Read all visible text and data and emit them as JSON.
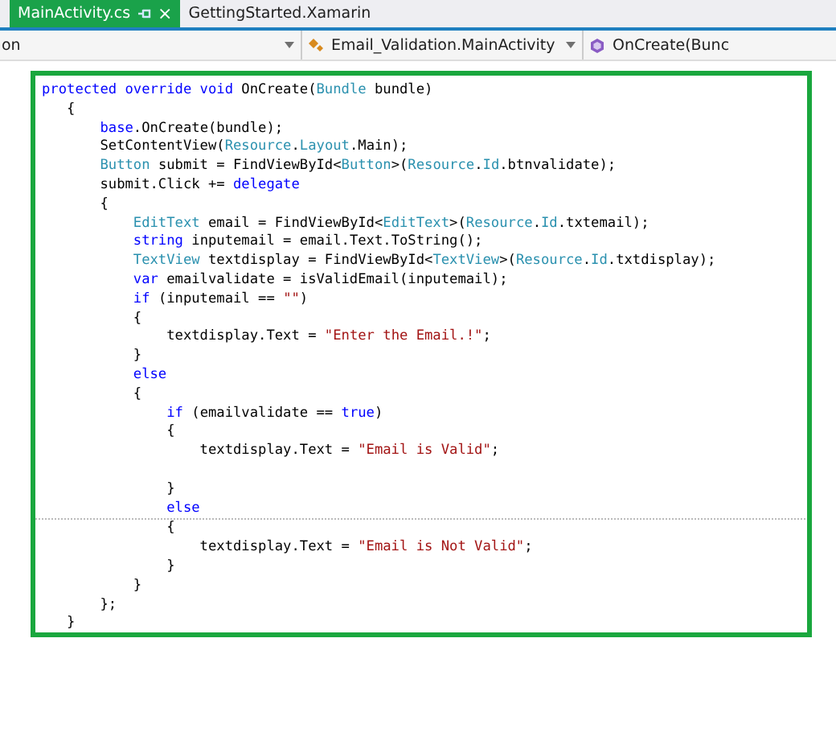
{
  "tabs": [
    {
      "label": "MainActivity.cs",
      "selected": true,
      "pinned": true,
      "close": "×"
    },
    {
      "label": "GettingStarted.Xamarin",
      "selected": false,
      "pinned": false
    }
  ],
  "navigation_bar": {
    "project": "on",
    "type": "Email_Validation.MainActivity",
    "member": "OnCreate(Bunc"
  },
  "code": {
    "highlighted": true,
    "lines": [
      {
        "kind": "code",
        "tokens": [
          {
            "kind": "keyword",
            "text": "protected override void"
          },
          {
            "kind": "plain",
            "text": " OnCreate("
          },
          {
            "kind": "type",
            "text": "Bundle"
          },
          {
            "kind": "plain",
            "text": " bundle)"
          }
        ]
      },
      {
        "kind": "code",
        "tokens": [
          {
            "kind": "plain",
            "text": "   {"
          }
        ]
      },
      {
        "kind": "code",
        "tokens": [
          {
            "kind": "keyword",
            "text": "       base"
          },
          {
            "kind": "plain",
            "text": ".OnCreate(bundle);"
          }
        ]
      },
      {
        "kind": "code",
        "tokens": [
          {
            "kind": "plain",
            "text": "       SetContentView("
          },
          {
            "kind": "type",
            "text": "Resource"
          },
          {
            "kind": "plain",
            "text": "."
          },
          {
            "kind": "type",
            "text": "Layout"
          },
          {
            "kind": "plain",
            "text": ".Main);"
          }
        ]
      },
      {
        "kind": "code",
        "tokens": [
          {
            "kind": "type",
            "text": "       Button"
          },
          {
            "kind": "plain",
            "text": " submit = FindViewById<"
          },
          {
            "kind": "type",
            "text": "Button"
          },
          {
            "kind": "plain",
            "text": ">("
          },
          {
            "kind": "type",
            "text": "Resource"
          },
          {
            "kind": "plain",
            "text": "."
          },
          {
            "kind": "type",
            "text": "Id"
          },
          {
            "kind": "plain",
            "text": ".btnvalidate);"
          }
        ]
      },
      {
        "kind": "code",
        "tokens": [
          {
            "kind": "plain",
            "text": "       submit.Click += "
          },
          {
            "kind": "keyword",
            "text": "delegate"
          }
        ]
      },
      {
        "kind": "code",
        "tokens": [
          {
            "kind": "plain",
            "text": "       {"
          }
        ]
      },
      {
        "kind": "code",
        "tokens": [
          {
            "kind": "type",
            "text": "           EditText"
          },
          {
            "kind": "plain",
            "text": " email = FindViewById<"
          },
          {
            "kind": "type",
            "text": "EditText"
          },
          {
            "kind": "plain",
            "text": ">("
          },
          {
            "kind": "type",
            "text": "Resource"
          },
          {
            "kind": "plain",
            "text": "."
          },
          {
            "kind": "type",
            "text": "Id"
          },
          {
            "kind": "plain",
            "text": ".txtemail);"
          }
        ]
      },
      {
        "kind": "code",
        "tokens": [
          {
            "kind": "keyword",
            "text": "           string"
          },
          {
            "kind": "plain",
            "text": " inputemail = email.Text.ToString();"
          }
        ]
      },
      {
        "kind": "code",
        "tokens": [
          {
            "kind": "type",
            "text": "           TextView"
          },
          {
            "kind": "plain",
            "text": " textdisplay = FindViewById<"
          },
          {
            "kind": "type",
            "text": "TextView"
          },
          {
            "kind": "plain",
            "text": ">("
          },
          {
            "kind": "type",
            "text": "Resource"
          },
          {
            "kind": "plain",
            "text": "."
          },
          {
            "kind": "type",
            "text": "Id"
          },
          {
            "kind": "plain",
            "text": ".txtdisplay);"
          }
        ]
      },
      {
        "kind": "code",
        "tokens": [
          {
            "kind": "keyword",
            "text": "           var"
          },
          {
            "kind": "plain",
            "text": " emailvalidate = isValidEmail(inputemail);"
          }
        ]
      },
      {
        "kind": "code",
        "tokens": [
          {
            "kind": "keyword",
            "text": "           if"
          },
          {
            "kind": "plain",
            "text": " (inputemail == "
          },
          {
            "kind": "string",
            "text": "\"\""
          },
          {
            "kind": "plain",
            "text": ")"
          }
        ]
      },
      {
        "kind": "code",
        "tokens": [
          {
            "kind": "plain",
            "text": "           {"
          }
        ]
      },
      {
        "kind": "code",
        "tokens": [
          {
            "kind": "plain",
            "text": "               textdisplay.Text = "
          },
          {
            "kind": "string",
            "text": "\"Enter the Email.!\""
          },
          {
            "kind": "plain",
            "text": ";"
          }
        ]
      },
      {
        "kind": "code",
        "tokens": [
          {
            "kind": "plain",
            "text": "           }"
          }
        ]
      },
      {
        "kind": "code",
        "tokens": [
          {
            "kind": "keyword",
            "text": "           else"
          }
        ]
      },
      {
        "kind": "code",
        "tokens": [
          {
            "kind": "plain",
            "text": "           {"
          }
        ]
      },
      {
        "kind": "code",
        "tokens": [
          {
            "kind": "keyword",
            "text": "               if"
          },
          {
            "kind": "plain",
            "text": " (emailvalidate == "
          },
          {
            "kind": "keyword",
            "text": "true"
          },
          {
            "kind": "plain",
            "text": ")"
          }
        ]
      },
      {
        "kind": "code",
        "tokens": [
          {
            "kind": "plain",
            "text": "               {"
          }
        ]
      },
      {
        "kind": "code",
        "tokens": [
          {
            "kind": "plain",
            "text": "                   textdisplay.Text = "
          },
          {
            "kind": "string",
            "text": "\"Email is Valid\""
          },
          {
            "kind": "plain",
            "text": ";"
          }
        ]
      },
      {
        "kind": "blank"
      },
      {
        "kind": "code",
        "tokens": [
          {
            "kind": "plain",
            "text": "               }"
          }
        ]
      },
      {
        "kind": "code",
        "tokens": [
          {
            "kind": "keyword",
            "text": "               else"
          }
        ]
      },
      {
        "kind": "code",
        "tokens": [
          {
            "kind": "plain",
            "text": "               {"
          }
        ]
      },
      {
        "kind": "code",
        "tokens": [
          {
            "kind": "plain",
            "text": "                   textdisplay.Text = "
          },
          {
            "kind": "string",
            "text": "\"Email is Not Valid\""
          },
          {
            "kind": "plain",
            "text": ";"
          }
        ]
      },
      {
        "kind": "code",
        "tokens": [
          {
            "kind": "plain",
            "text": "               }"
          }
        ]
      },
      {
        "kind": "code",
        "tokens": [
          {
            "kind": "plain",
            "text": "           }"
          }
        ]
      },
      {
        "kind": "code",
        "tokens": [
          {
            "kind": "plain",
            "text": "       };"
          }
        ]
      },
      {
        "kind": "code",
        "tokens": [
          {
            "kind": "plain",
            "text": "   }"
          }
        ]
      }
    ]
  }
}
